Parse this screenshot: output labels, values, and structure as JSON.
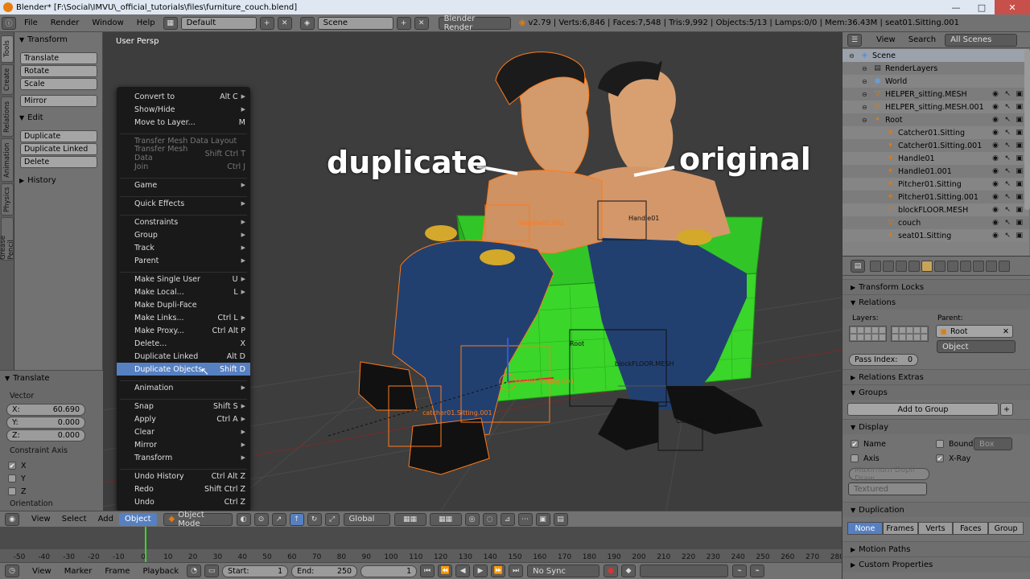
{
  "window": {
    "title": "Blender* [F:\\Social\\IMVU\\_official_tutorials\\files\\furniture_couch.blend]",
    "min": "—",
    "max": "□",
    "close": "✕"
  },
  "info_header": {
    "menus": [
      "File",
      "Render",
      "Window",
      "Help"
    ],
    "screen": "Default",
    "scene": "Scene",
    "engine": "Blender Render",
    "stats": "v2.79 | Verts:6,846 | Faces:7,548 | Tris:9,992 | Objects:5/13 | Lamps:0/0 | Mem:36.43M | seat01.Sitting.001"
  },
  "shelf_tabs": [
    "Tools",
    "Create",
    "Relations",
    "Animation",
    "Physics",
    "Grease Pencil"
  ],
  "tool_shelf": {
    "transform_title": "Transform",
    "transform_buttons": [
      "Translate",
      "Rotate",
      "Scale"
    ],
    "mirror": "Mirror",
    "edit_title": "Edit",
    "edit_buttons": [
      "Duplicate",
      "Duplicate Linked",
      "Delete"
    ],
    "history_title": "History"
  },
  "operator_panel": {
    "title": "Translate",
    "vector_label": "Vector",
    "x_label": "X:",
    "x_value": "60.690",
    "y_label": "Y:",
    "y_value": "0.000",
    "z_label": "Z:",
    "z_value": "0.000",
    "constraint_label": "Constraint Axis",
    "axes": [
      {
        "label": "X",
        "checked": true
      },
      {
        "label": "Y",
        "checked": false
      },
      {
        "label": "Z",
        "checked": false
      }
    ],
    "orientation_label": "Orientation"
  },
  "viewport": {
    "label": "User Persp",
    "annotation_left": "duplicate",
    "annotation_right": "original",
    "object_labels": [
      "Handle01.001",
      "Handle01",
      "Root",
      "seat01.Sitting.001",
      "blockFLOOR.MESH",
      "catcher01.Sitting.001",
      "Catcher01.Sitting"
    ]
  },
  "context_menu": {
    "groups": [
      [
        {
          "label": "Convert to",
          "shortcut": "Alt C",
          "submenu": true,
          "dim": false
        },
        {
          "label": "Show/Hide",
          "shortcut": "",
          "submenu": true,
          "dim": false
        },
        {
          "label": "Move to Layer...",
          "shortcut": "M",
          "submenu": false,
          "dim": false
        }
      ],
      [
        {
          "label": "Transfer Mesh Data Layout",
          "shortcut": "",
          "submenu": false,
          "dim": true
        },
        {
          "label": "Transfer Mesh Data",
          "shortcut": "Shift Ctrl T",
          "submenu": false,
          "dim": true
        },
        {
          "label": "Join",
          "shortcut": "Ctrl J",
          "submenu": false,
          "dim": true
        }
      ],
      [
        {
          "label": "Game",
          "shortcut": "",
          "submenu": true,
          "dim": false
        }
      ],
      [
        {
          "label": "Quick Effects",
          "shortcut": "",
          "submenu": true,
          "dim": false
        }
      ],
      [
        {
          "label": "Constraints",
          "shortcut": "",
          "submenu": true,
          "dim": false
        },
        {
          "label": "Group",
          "shortcut": "",
          "submenu": true,
          "dim": false
        },
        {
          "label": "Track",
          "shortcut": "",
          "submenu": true,
          "dim": false
        },
        {
          "label": "Parent",
          "shortcut": "",
          "submenu": true,
          "dim": false
        }
      ],
      [
        {
          "label": "Make Single User",
          "shortcut": "U",
          "submenu": true,
          "dim": false
        },
        {
          "label": "Make Local...",
          "shortcut": "L",
          "submenu": true,
          "dim": false
        },
        {
          "label": "Make Dupli-Face",
          "shortcut": "",
          "submenu": false,
          "dim": false
        },
        {
          "label": "Make Links...",
          "shortcut": "Ctrl L",
          "submenu": true,
          "dim": false
        },
        {
          "label": "Make Proxy...",
          "shortcut": "Ctrl Alt P",
          "submenu": false,
          "dim": false
        },
        {
          "label": "Delete...",
          "shortcut": "X",
          "submenu": false,
          "dim": false
        },
        {
          "label": "Duplicate Linked",
          "shortcut": "Alt D",
          "submenu": false,
          "dim": false
        },
        {
          "label": "Duplicate Objects",
          "shortcut": "Shift D",
          "submenu": false,
          "dim": false,
          "active": true
        }
      ],
      [
        {
          "label": "Animation",
          "shortcut": "",
          "submenu": true,
          "dim": false
        }
      ],
      [
        {
          "label": "Snap",
          "shortcut": "Shift S",
          "submenu": true,
          "dim": false
        },
        {
          "label": "Apply",
          "shortcut": "Ctrl A",
          "submenu": true,
          "dim": false
        },
        {
          "label": "Clear",
          "shortcut": "",
          "submenu": true,
          "dim": false
        },
        {
          "label": "Mirror",
          "shortcut": "",
          "submenu": true,
          "dim": false
        },
        {
          "label": "Transform",
          "shortcut": "",
          "submenu": true,
          "dim": false
        }
      ],
      [
        {
          "label": "Undo History",
          "shortcut": "Ctrl Alt Z",
          "submenu": false,
          "dim": false
        },
        {
          "label": "Redo",
          "shortcut": "Shift Ctrl Z",
          "submenu": false,
          "dim": false
        },
        {
          "label": "Undo",
          "shortcut": "Ctrl Z",
          "submenu": false,
          "dim": false
        }
      ]
    ]
  },
  "vp_header": {
    "menus": [
      "View",
      "Select",
      "Add",
      "Object"
    ],
    "active_menu": "Object",
    "mode": "Object Mode",
    "orientation": "Global"
  },
  "timeline": {
    "ticks": [
      "-50",
      "-40",
      "-30",
      "-20",
      "-10",
      "0",
      "10",
      "20",
      "30",
      "40",
      "50",
      "60",
      "70",
      "80",
      "90",
      "100",
      "110",
      "120",
      "130",
      "140",
      "150",
      "160",
      "170",
      "180",
      "190",
      "200",
      "210",
      "220",
      "230",
      "240",
      "250",
      "260",
      "270",
      "280"
    ],
    "current_frame": 1,
    "menus": [
      "View",
      "Marker",
      "Frame",
      "Playback"
    ],
    "start_label": "Start:",
    "start": "1",
    "end_label": "End:",
    "end": "250",
    "frame": "1",
    "sync": "No Sync"
  },
  "outliner": {
    "menus": [
      "View",
      "Search"
    ],
    "filter": "All Scenes",
    "rows": [
      {
        "label": "Scene",
        "indent": 0,
        "icon": "scene-icon",
        "glyph": "◈",
        "color": "#5a8ed8",
        "vis": false,
        "sel": true
      },
      {
        "label": "RenderLayers",
        "indent": 1,
        "icon": "renderlayer-icon",
        "glyph": "▤",
        "color": "#222",
        "vis": false
      },
      {
        "label": "World",
        "indent": 1,
        "icon": "world-icon",
        "glyph": "●",
        "color": "#6b9ad1",
        "vis": false
      },
      {
        "label": "HELPER_sitting.MESH",
        "indent": 1,
        "icon": "mesh-icon",
        "glyph": "▽",
        "color": "#e07b10",
        "vis": true
      },
      {
        "label": "HELPER_sitting.MESH.001",
        "indent": 1,
        "icon": "mesh-icon",
        "glyph": "▽",
        "color": "#e07b10",
        "vis": true
      },
      {
        "label": "Root",
        "indent": 1,
        "icon": "empty-icon",
        "glyph": "✶",
        "color": "#e07b10",
        "vis": true
      },
      {
        "label": "Catcher01.Sitting",
        "indent": 2,
        "icon": "empty-icon",
        "glyph": "✶",
        "color": "#e07b10",
        "vis": true
      },
      {
        "label": "Catcher01.Sitting.001",
        "indent": 2,
        "icon": "empty-icon",
        "glyph": "✶",
        "color": "#e07b10",
        "vis": true
      },
      {
        "label": "Handle01",
        "indent": 2,
        "icon": "empty-icon",
        "glyph": "✶",
        "color": "#e07b10",
        "vis": true
      },
      {
        "label": "Handle01.001",
        "indent": 2,
        "icon": "empty-icon",
        "glyph": "✶",
        "color": "#e07b10",
        "vis": true
      },
      {
        "label": "Pitcher01.Sitting",
        "indent": 2,
        "icon": "empty-icon",
        "glyph": "✶",
        "color": "#e07b10",
        "vis": true
      },
      {
        "label": "Pitcher01.Sitting.001",
        "indent": 2,
        "icon": "empty-icon",
        "glyph": "✶",
        "color": "#e07b10",
        "vis": true
      },
      {
        "label": "blockFLOOR.MESH",
        "indent": 2,
        "icon": "mesh-icon",
        "glyph": "▽",
        "color": "#e07b10",
        "vis": true
      },
      {
        "label": "couch",
        "indent": 2,
        "icon": "mesh-icon",
        "glyph": "▽",
        "color": "#e07b10",
        "vis": true
      },
      {
        "label": "seat01.Sitting",
        "indent": 2,
        "icon": "empty-icon",
        "glyph": "✶",
        "color": "#e07b10",
        "vis": true
      }
    ]
  },
  "properties": {
    "transform_locks": "Transform Locks",
    "relations": "Relations",
    "layers_label": "Layers:",
    "parent_label": "Parent:",
    "parent_value": "Root",
    "parent_type": "Object",
    "pass_index_label": "Pass Index:",
    "pass_index": "0",
    "relations_extras": "Relations Extras",
    "groups": "Groups",
    "add_to_group": "Add to Group",
    "display": "Display",
    "name_label": "Name",
    "bound_label": "Bound",
    "bound_type": "Box",
    "axis_label": "Axis",
    "xray_label": "X-Ray",
    "max_dupli": "Maximum Dupli Draw...",
    "draw_type": "Textured",
    "duplication": "Duplication",
    "dup_options": [
      "None",
      "Frames",
      "Verts",
      "Faces",
      "Group"
    ],
    "dup_active": "None",
    "motion_paths": "Motion Paths",
    "custom_properties": "Custom Properties"
  },
  "colors": {
    "accent": "#5680c2",
    "selected_orange": "#ff7a1a",
    "couch_green": "#3ad62a",
    "jeans_blue": "#23406f"
  }
}
